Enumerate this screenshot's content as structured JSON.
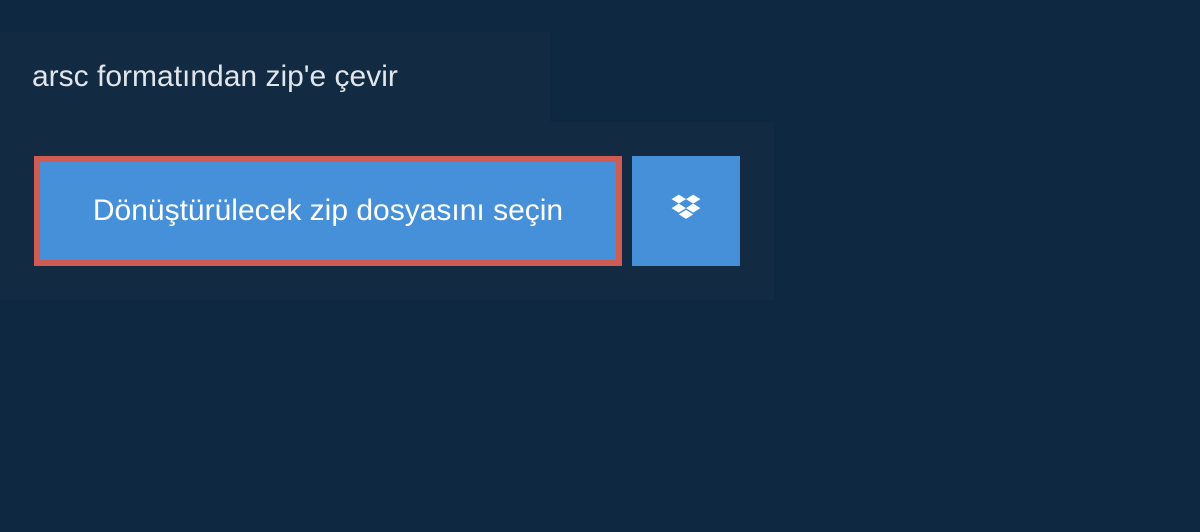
{
  "header": {
    "title": "arsc formatından zip'e çevir"
  },
  "main": {
    "select_button_label": "Dönüştürülecek zip dosyasını seçin"
  },
  "colors": {
    "background": "#0d2840",
    "panel": "#122a42",
    "button_primary": "#4590d9",
    "button_border": "#cf5b52"
  }
}
